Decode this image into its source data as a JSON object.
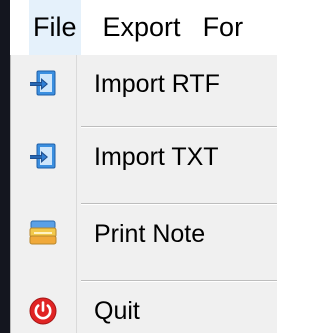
{
  "menubar": {
    "items": [
      {
        "label": "File"
      },
      {
        "label": "Export"
      },
      {
        "label": "For"
      }
    ]
  },
  "file_menu": {
    "items": [
      {
        "label": "Import RTF",
        "icon": "import-document-icon"
      },
      {
        "label": "Import TXT",
        "icon": "import-document-icon"
      },
      {
        "label": "Print Note",
        "icon": "printer-icon"
      },
      {
        "label": "Quit",
        "icon": "power-icon"
      }
    ]
  },
  "colors": {
    "menu_background": "#f0f0f0",
    "import_icon_blue": "#2a78c8",
    "import_arrow_dark": "#1f4f8f",
    "power_icon_red": "#e02424",
    "printer_yellow": "#f2c94c"
  }
}
